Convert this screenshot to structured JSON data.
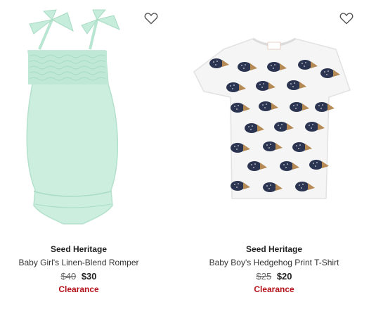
{
  "products": [
    {
      "brand": "Seed Heritage",
      "name": "Baby Girl's Linen-Blend Romper",
      "original_price": "$40",
      "sale_price": "$30",
      "badge": "Clearance",
      "image_icon": "romper-image",
      "color": "#c9eedd"
    },
    {
      "brand": "Seed Heritage",
      "name": "Baby Boy's Hedgehog Print T-Shirt",
      "original_price": "$25",
      "sale_price": "$20",
      "badge": "Clearance",
      "image_icon": "hedgehog-tshirt-image",
      "color": "#2b3451"
    }
  ],
  "icons": {
    "wishlist": "heart-outline-icon"
  },
  "colors": {
    "clearance": "#b5121b",
    "heart": "#555555"
  }
}
